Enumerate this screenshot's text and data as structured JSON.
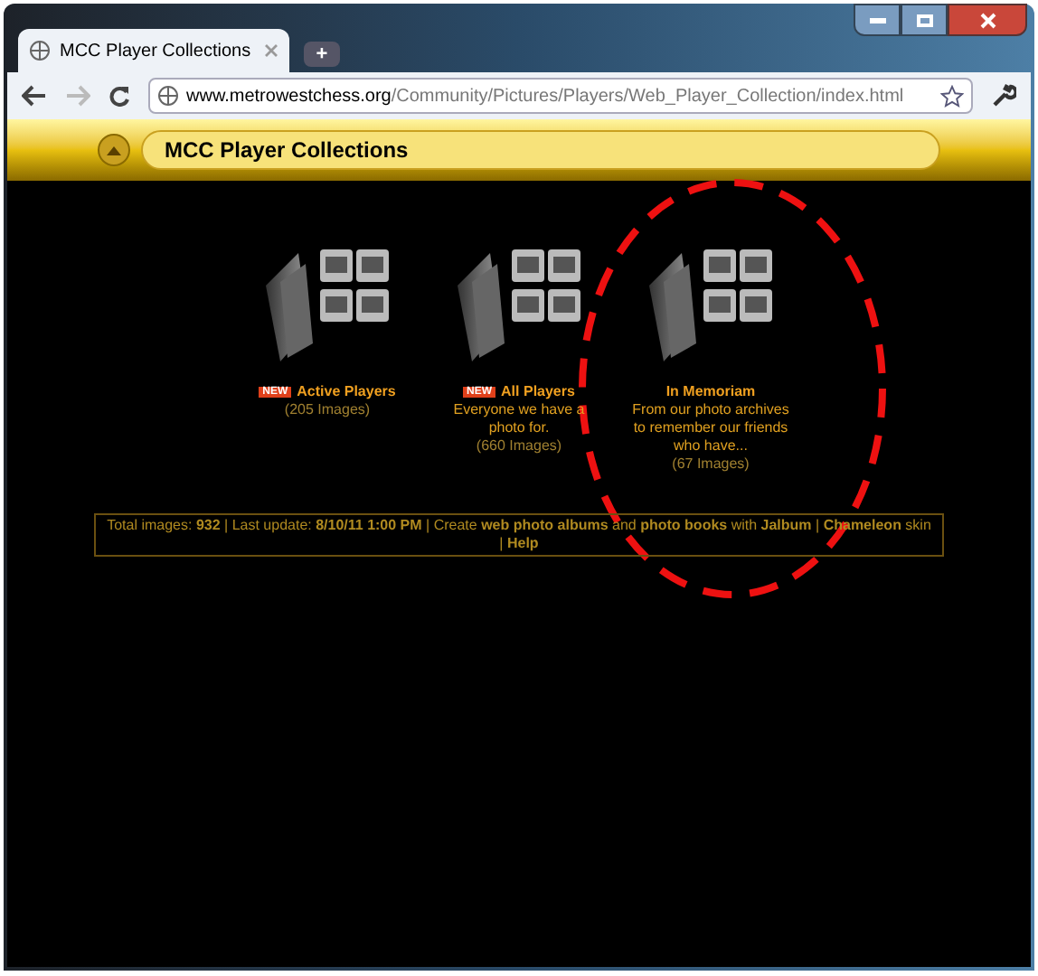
{
  "browser": {
    "tab_title": "MCC Player Collections",
    "new_tab": "+",
    "url_host": "www.metrowestchess.org",
    "url_path": "/Community/Pictures/Players/Web_Player_Collection/index.html"
  },
  "header": {
    "title": "MCC Player Collections"
  },
  "albums": [
    {
      "is_new": true,
      "badge": "NEW",
      "title": "Active Players",
      "count": "(205 Images)"
    },
    {
      "is_new": true,
      "badge": "NEW",
      "title": "All Players",
      "description": "Everyone we have a photo for.",
      "count": "(660 Images)"
    },
    {
      "is_new": false,
      "title": "In Memoriam",
      "description": "From our photo archives to remember our friends who have...",
      "count": "(67 Images)"
    }
  ],
  "footer": "Total images: **932** | Last update: **8/10/11 1:00 PM** | Create **web photo albums** and **photo books** with **Jalbum** | **Chameleon** skin | **Help**",
  "annotation": {
    "kind": "dashed-ellipse"
  }
}
